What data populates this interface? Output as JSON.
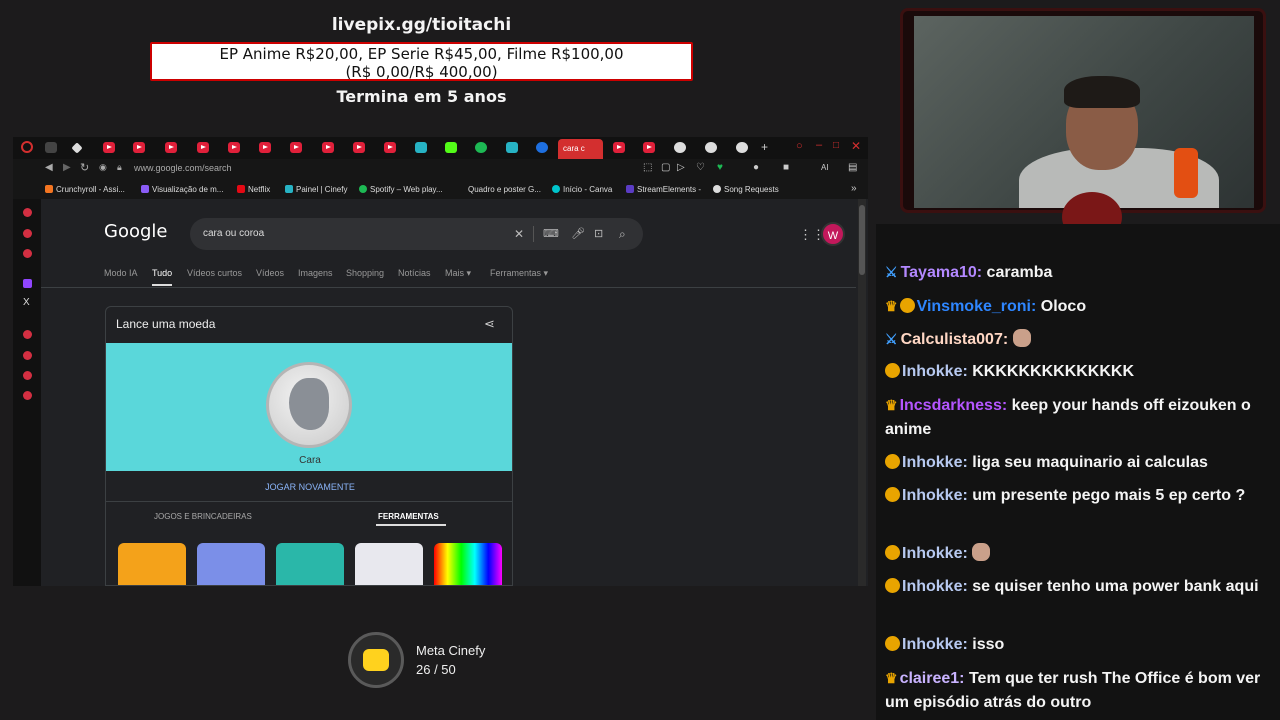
{
  "overlay": {
    "livepix": "livepix.gg/tioitachi",
    "prices_line1": "EP Anime R$20,00, EP Serie R$45,00, Filme R$100,00",
    "prices_line2": "(R$ 0,00/R$ 400,00)",
    "ends": "Termina em 5 anos"
  },
  "browser": {
    "active_tab": "cara c",
    "url": "www.google.com/search",
    "bookmarks": [
      "Crunchyroll - Assi...",
      "Visualização de m...",
      "Netflix",
      "Painel | Cinefy",
      "Spotify – Web play...",
      "Quadro e poster G...",
      "Início - Canva",
      "StreamElements -",
      "Song Requests"
    ]
  },
  "google": {
    "logo": "Google",
    "query": "cara ou coroa",
    "avatar_letter": "W",
    "tabs": [
      "Modo IA",
      "Tudo",
      "Vídeos curtos",
      "Vídeos",
      "Imagens",
      "Shopping",
      "Notícias",
      "Mais",
      "Ferramentas"
    ],
    "active_tab": "Tudo",
    "card_title": "Lance uma moeda",
    "coin_label": "Cara",
    "replay": "JOGAR NOVAMENTE",
    "cat_games": "JOGOS E BRINCADEIRAS",
    "cat_tools": "FERRAMENTAS"
  },
  "meta": {
    "title": "Meta Cinefy",
    "count": "26 / 50"
  },
  "chat": [
    {
      "badge": "sword",
      "user": "Tayama10:",
      "color": "#b388ff",
      "text": "caramba"
    },
    {
      "badge": "crown1",
      "user": "Vinsmoke_roni:",
      "color": "#2e86ff",
      "text": "Oloco"
    },
    {
      "badge": "sword",
      "user": "Calculista007:",
      "color": "#ffd7c4",
      "text": "",
      "emote": true
    },
    {
      "badge": "one",
      "user": "Inhokke:",
      "color": "#b7c9f0",
      "text": "KKKKKKKKKKKKKK"
    },
    {
      "badge": "crown",
      "user": "Incsdarkness:",
      "color": "#b455ff",
      "text": "keep your hands off eizouken o anime"
    },
    {
      "badge": "one",
      "user": "Inhokke:",
      "color": "#b7c9f0",
      "text": "liga seu maquinario ai calculas"
    },
    {
      "badge": "one",
      "user": "Inhokke:",
      "color": "#b7c9f0",
      "text": "um presente pego mais 5 ep certo ?"
    },
    {
      "badge": "one",
      "user": "Inhokke:",
      "color": "#b7c9f0",
      "text": "",
      "emote": true
    },
    {
      "badge": "one",
      "user": "Inhokke:",
      "color": "#b7c9f0",
      "text": "se quiser tenho uma power bank aqui"
    },
    {
      "badge": "one",
      "user": "Inhokke:",
      "color": "#b7c9f0",
      "text": "isso"
    },
    {
      "badge": "crown",
      "user": "clairee1:",
      "color": "#c9b3ff",
      "text": "Tem que ter rush The Office é bom ver um episódio atrás do outro"
    }
  ]
}
